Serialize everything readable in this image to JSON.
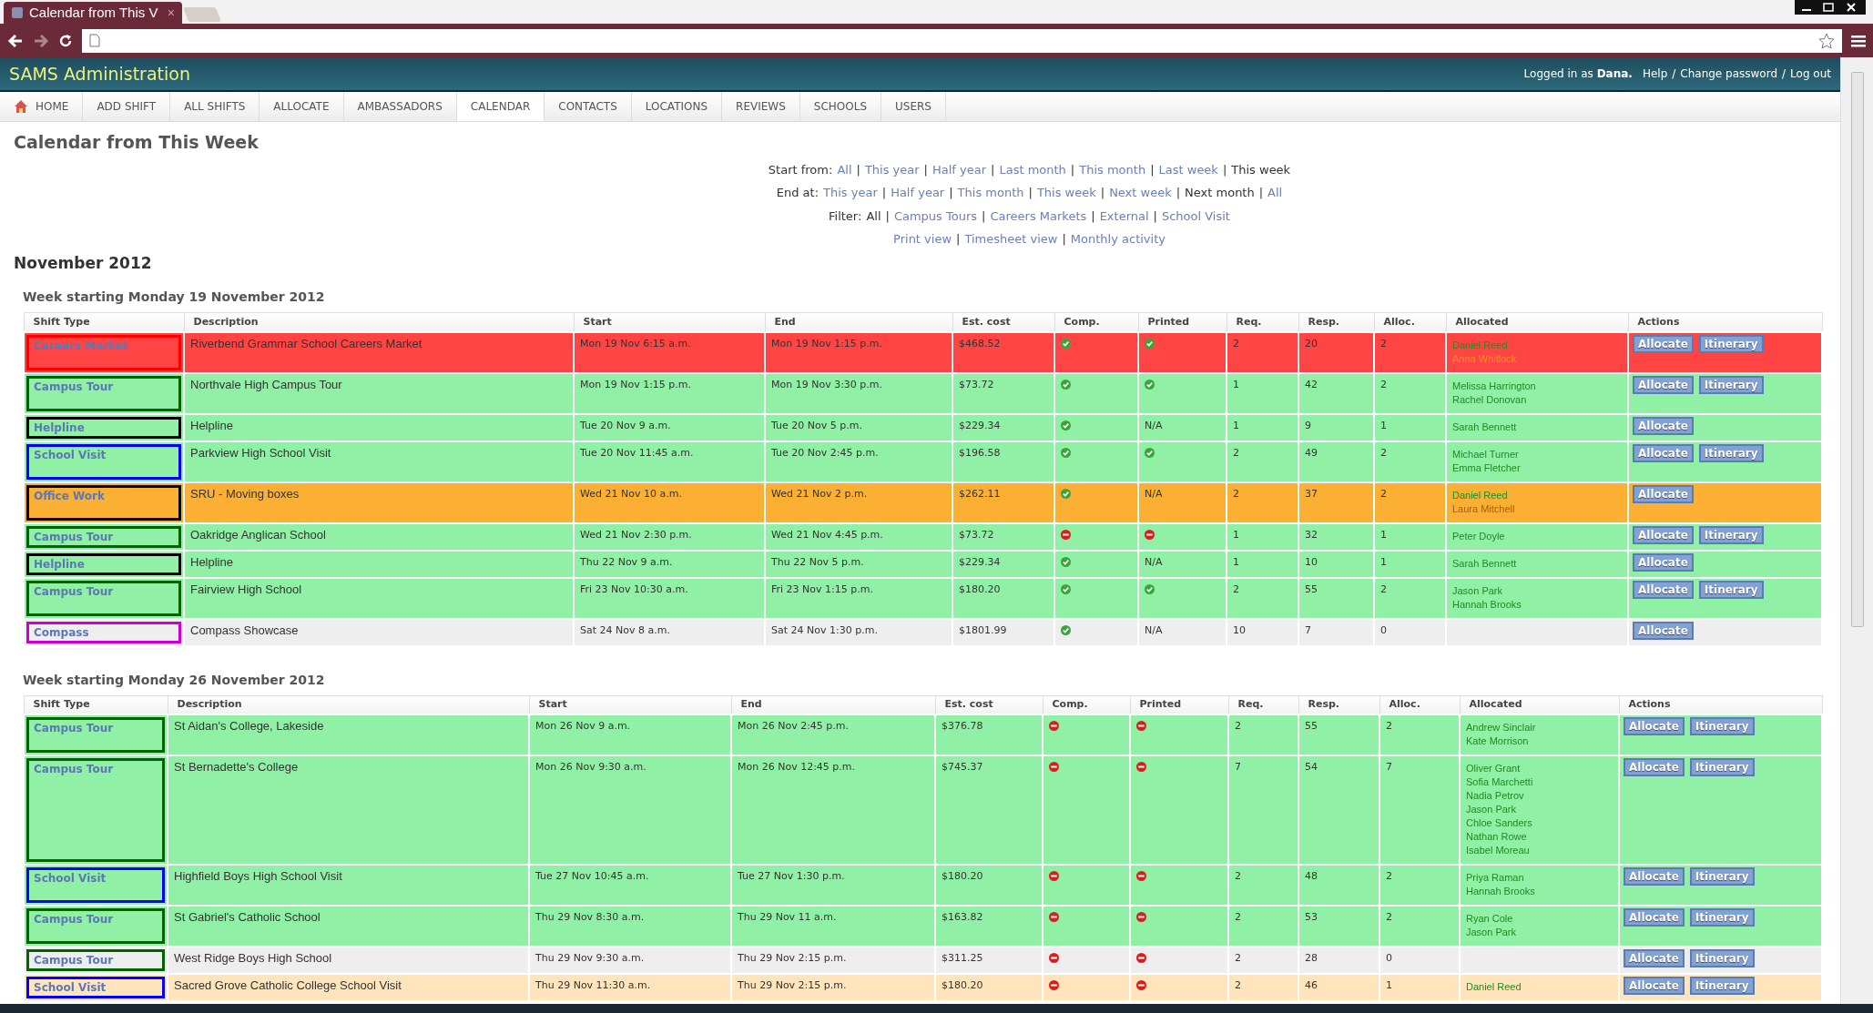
{
  "browser": {
    "tab_title": "Calendar from This V",
    "tab_close": "×"
  },
  "header": {
    "title": "SAMS Administration",
    "user_info": "Logged in as **Dana.**",
    "links": [
      "Help",
      "Change password",
      "Log out"
    ],
    "separator": "/"
  },
  "nav": [
    {
      "label": "HOME",
      "selected": false
    },
    {
      "label": "ADD SHIFT",
      "selected": false
    },
    {
      "label": "ALL SHIFTS",
      "selected": false
    },
    {
      "label": "ALLOCATE",
      "selected": false
    },
    {
      "label": "AMBASSADORS",
      "selected": false
    },
    {
      "label": "CALENDAR",
      "selected": true
    },
    {
      "label": "CONTACTS",
      "selected": false
    },
    {
      "label": "LOCATIONS",
      "selected": false
    },
    {
      "label": "REVIEWS",
      "selected": false
    },
    {
      "label": "SCHOOLS",
      "selected": false
    },
    {
      "label": "USERS",
      "selected": false
    }
  ],
  "page_title": "Calendar from This Week",
  "filters": [
    {
      "label": "Start from:",
      "separator": "|",
      "options": [
        {
          "text": "All",
          "selected": false
        },
        {
          "text": "This year",
          "selected": false
        },
        {
          "text": "Half year",
          "selected": false
        },
        {
          "text": "Last month",
          "selected": false
        },
        {
          "text": "This month",
          "selected": false
        },
        {
          "text": "Last week",
          "selected": false
        },
        {
          "text": "This week",
          "selected": true
        }
      ]
    },
    {
      "label": "End at:",
      "separator": "|",
      "options": [
        {
          "text": "This year",
          "selected": false
        },
        {
          "text": "Half year",
          "selected": false
        },
        {
          "text": "This month",
          "selected": false
        },
        {
          "text": "This week",
          "selected": false
        },
        {
          "text": "Next week",
          "selected": false
        },
        {
          "text": "Next month",
          "selected": true
        },
        {
          "text": "All",
          "selected": false
        }
      ]
    },
    {
      "label": "Filter:",
      "separator": "|",
      "options": [
        {
          "text": "All",
          "selected": true
        },
        {
          "text": "Campus Tours",
          "selected": false
        },
        {
          "text": "Careers Markets",
          "selected": false
        },
        {
          "text": "External",
          "selected": false
        },
        {
          "text": "School Visit",
          "selected": false
        }
      ]
    },
    {
      "separator": "|",
      "options": [
        {
          "text": "Print view",
          "selected": false
        },
        {
          "text": "Timesheet view",
          "selected": false
        },
        {
          "text": "Monthly activity",
          "selected": false
        }
      ]
    }
  ],
  "month": "November 2012",
  "weeks": [
    {
      "heading": "Week starting Monday 19 November 2012",
      "columns": [
        "Shift Type",
        "Description",
        "Start",
        "End",
        "Est. cost",
        "Comp.",
        "Printed",
        "Req.",
        "Resp.",
        "Alloc.",
        "Allocated",
        "Actions"
      ],
      "rows": [
        {
          "color": "#ff4444",
          "shift_type": {
            "label": "Careers Market",
            "color": "#ff0000"
          },
          "description": "Riverbend Grammar School Careers Market",
          "start": "Mon 19 Nov 6:15 a.m.",
          "end": "Mon 19 Nov 1:15 p.m.",
          "cost": "$468.52",
          "comp": true,
          "printed": {
            "kind": "mark",
            "done": true
          },
          "req": "2",
          "resp": "20",
          "alloc": "2",
          "allocated": [
            {
              "name": "Daniel Reed",
              "color": "#1e8c1e"
            },
            {
              "name": "Anna Whitlock",
              "color": "#e8961e"
            }
          ],
          "actions": [
            "Allocate",
            "Itinerary"
          ]
        },
        {
          "color": "#90f0a6",
          "shift_type": {
            "label": "Campus Tour",
            "color": "#006400"
          },
          "description": "Northvale High Campus Tour",
          "start": "Mon 19 Nov 1:15 p.m.",
          "end": "Mon 19 Nov 3:30 p.m.",
          "cost": "$73.72",
          "comp": true,
          "printed": {
            "kind": "mark",
            "done": true
          },
          "req": "1",
          "resp": "42",
          "alloc": "2",
          "allocated": [
            {
              "name": "Melissa Harrington",
              "color": "#1e8c1e"
            },
            {
              "name": "Rachel Donovan",
              "color": "#1e8c1e"
            }
          ],
          "actions": [
            "Allocate",
            "Itinerary"
          ]
        },
        {
          "color": "#90f0a6",
          "shift_type": {
            "label": "Helpline",
            "color": "#000000"
          },
          "description": "Helpline",
          "start": "Tue 20 Nov 9 a.m.",
          "end": "Tue 20 Nov 5 p.m.",
          "cost": "$229.34",
          "comp": true,
          "printed": {
            "kind": "text",
            "text": "N/A"
          },
          "req": "1",
          "resp": "9",
          "alloc": "1",
          "allocated": [
            {
              "name": "Sarah Bennett",
              "color": "#1e8c1e"
            }
          ],
          "actions": [
            "Allocate"
          ]
        },
        {
          "color": "#90f0a6",
          "shift_type": {
            "label": "School Visit",
            "color": "#0000ff"
          },
          "description": "Parkview High School Visit",
          "start": "Tue 20 Nov 11:45 a.m.",
          "end": "Tue 20 Nov 2:45 p.m.",
          "cost": "$196.58",
          "comp": true,
          "printed": {
            "kind": "mark",
            "done": true
          },
          "req": "2",
          "resp": "49",
          "alloc": "2",
          "allocated": [
            {
              "name": "Michael Turner",
              "color": "#1e8c1e"
            },
            {
              "name": "Emma Fletcher",
              "color": "#1e8c1e"
            }
          ],
          "actions": [
            "Allocate",
            "Itinerary"
          ]
        },
        {
          "color": "#fbb034",
          "shift_type": {
            "label": "Office Work",
            "color": "#000000"
          },
          "description": "SRU - Moving boxes",
          "start": "Wed 21 Nov 10 a.m.",
          "end": "Wed 21 Nov 2 p.m.",
          "cost": "$262.11",
          "comp": true,
          "printed": {
            "kind": "text",
            "text": "N/A"
          },
          "req": "2",
          "resp": "37",
          "alloc": "2",
          "allocated": [
            {
              "name": "Daniel Reed",
              "color": "#1e8c1e"
            },
            {
              "name": "Laura Mitchell",
              "color": "#a85a08"
            }
          ],
          "actions": [
            "Allocate"
          ]
        },
        {
          "color": "#90f0a6",
          "shift_type": {
            "label": "Campus Tour",
            "color": "#006400"
          },
          "description": "Oakridge Anglican School",
          "start": "Wed 21 Nov 2:30 p.m.",
          "end": "Wed 21 Nov 4:45 p.m.",
          "cost": "$73.72",
          "comp": false,
          "printed": {
            "kind": "mark",
            "done": false
          },
          "req": "1",
          "resp": "32",
          "alloc": "1",
          "allocated": [
            {
              "name": "Peter Doyle",
              "color": "#1e8c1e"
            }
          ],
          "actions": [
            "Allocate",
            "Itinerary"
          ]
        },
        {
          "color": "#90f0a6",
          "shift_type": {
            "label": "Helpline",
            "color": "#000000"
          },
          "description": "Helpline",
          "start": "Thu 22 Nov 9 a.m.",
          "end": "Thu 22 Nov 5 p.m.",
          "cost": "$229.34",
          "comp": true,
          "printed": {
            "kind": "text",
            "text": "N/A"
          },
          "req": "1",
          "resp": "10",
          "alloc": "1",
          "allocated": [
            {
              "name": "Sarah Bennett",
              "color": "#1e8c1e"
            }
          ],
          "actions": [
            "Allocate"
          ]
        },
        {
          "color": "#90f0a6",
          "shift_type": {
            "label": "Campus Tour",
            "color": "#006400"
          },
          "description": "Fairview High School",
          "start": "Fri 23 Nov 10:30 a.m.",
          "end": "Fri 23 Nov 1:15 p.m.",
          "cost": "$180.20",
          "comp": true,
          "printed": {
            "kind": "mark",
            "done": true
          },
          "req": "2",
          "resp": "55",
          "alloc": "2",
          "allocated": [
            {
              "name": "Jason Park",
              "color": "#1e8c1e"
            },
            {
              "name": "Hannah Brooks",
              "color": "#1e8c1e"
            }
          ],
          "actions": [
            "Allocate",
            "Itinerary"
          ]
        },
        {
          "color": "#eeeeee",
          "shift_type": {
            "label": "Compass",
            "color": "#cc00cc"
          },
          "description": "Compass Showcase",
          "start": "Sat 24 Nov 8 a.m.",
          "end": "Sat 24 Nov 1:30 p.m.",
          "cost": "$1801.99",
          "comp": true,
          "printed": {
            "kind": "text",
            "text": "N/A"
          },
          "req": "10",
          "resp": "7",
          "alloc": "0",
          "actions": [
            "Allocate"
          ]
        }
      ]
    },
    {
      "heading": "Week starting Monday 26 November 2012",
      "columns": [
        "Shift Type",
        "Description",
        "Start",
        "End",
        "Est. cost",
        "Comp.",
        "Printed",
        "Req.",
        "Resp.",
        "Alloc.",
        "Allocated",
        "Actions"
      ],
      "rows": [
        {
          "color": "#90f0a6",
          "shift_type": {
            "label": "Campus Tour",
            "color": "#006400"
          },
          "description": "St Aidan's College, Lakeside",
          "start": "Mon 26 Nov 9 a.m.",
          "end": "Mon 26 Nov 2:45 p.m.",
          "cost": "$376.78",
          "comp": false,
          "printed": {
            "kind": "mark",
            "done": false
          },
          "req": "2",
          "resp": "55",
          "alloc": "2",
          "allocated": [
            {
              "name": "Andrew Sinclair",
              "color": "#1e8c1e"
            },
            {
              "name": "Kate Morrison",
              "color": "#1e8c1e"
            }
          ],
          "actions": [
            "Allocate",
            "Itinerary"
          ]
        },
        {
          "color": "#90f0a6",
          "shift_type": {
            "label": "Campus Tour",
            "color": "#006400"
          },
          "description": "St Bernadette's College",
          "start": "Mon 26 Nov 9:30 a.m.",
          "end": "Mon 26 Nov 12:45 p.m.",
          "cost": "$745.37",
          "comp": false,
          "printed": {
            "kind": "mark",
            "done": false
          },
          "req": "7",
          "resp": "54",
          "alloc": "7",
          "allocated": [
            {
              "name": "Oliver Grant",
              "color": "#1e8c1e"
            },
            {
              "name": "Sofia Marchetti",
              "color": "#1e8c1e"
            },
            {
              "name": "Nadia Petrov",
              "color": "#1e8c1e"
            },
            {
              "name": "Jason Park",
              "color": "#1e8c1e"
            },
            {
              "name": "Chloe Sanders",
              "color": "#1e8c1e"
            },
            {
              "name": "Nathan Rowe",
              "color": "#1e8c1e"
            },
            {
              "name": "Isabel Moreau",
              "color": "#1e8c1e"
            }
          ],
          "actions": [
            "Allocate",
            "Itinerary"
          ]
        },
        {
          "color": "#90f0a6",
          "shift_type": {
            "label": "School Visit",
            "color": "#0000ff"
          },
          "description": "Highfield Boys High School Visit",
          "start": "Tue 27 Nov 10:45 a.m.",
          "end": "Tue 27 Nov 1:30 p.m.",
          "cost": "$180.20",
          "comp": false,
          "printed": {
            "kind": "mark",
            "done": false
          },
          "req": "2",
          "resp": "48",
          "alloc": "2",
          "allocated": [
            {
              "name": "Priya Raman",
              "color": "#1e8c1e"
            },
            {
              "name": "Hannah Brooks",
              "color": "#1e8c1e"
            }
          ],
          "actions": [
            "Allocate",
            "Itinerary"
          ]
        },
        {
          "color": "#90f0a6",
          "shift_type": {
            "label": "Campus Tour",
            "color": "#006400"
          },
          "description": "St Gabriel's Catholic School",
          "start": "Thu 29 Nov 8:30 a.m.",
          "end": "Thu 29 Nov 11 a.m.",
          "cost": "$163.82",
          "comp": false,
          "printed": {
            "kind": "mark",
            "done": false
          },
          "req": "2",
          "resp": "53",
          "alloc": "2",
          "allocated": [
            {
              "name": "Ryan Cole",
              "color": "#1e8c1e"
            },
            {
              "name": "Jason Park",
              "color": "#1e8c1e"
            }
          ],
          "actions": [
            "Allocate",
            "Itinerary"
          ]
        },
        {
          "color": "#eeeeee",
          "shift_type": {
            "label": "Campus Tour",
            "color": "#006400"
          },
          "description": "West Ridge Boys High School",
          "start": "Thu 29 Nov 9:30 a.m.",
          "end": "Thu 29 Nov 2:15 p.m.",
          "cost": "$311.25",
          "comp": false,
          "printed": {
            "kind": "mark",
            "done": false
          },
          "req": "2",
          "resp": "28",
          "alloc": "0",
          "actions": [
            "Allocate",
            "Itinerary"
          ]
        },
        {
          "color": "#ffe4bc",
          "shift_type": {
            "label": "School Visit",
            "color": "#0000ff"
          },
          "description": "Sacred Grove Catholic College School Visit",
          "start": "Thu 29 Nov 11:30 a.m.",
          "end": "Thu 29 Nov 2:15 p.m.",
          "cost": "$180.20",
          "comp": false,
          "printed": {
            "kind": "mark",
            "done": false
          },
          "req": "2",
          "resp": "46",
          "alloc": "1",
          "allocated": [
            {
              "name": "Daniel Reed",
              "color": "#1e8c1e"
            }
          ],
          "actions": [
            "Allocate",
            "Itinerary"
          ]
        }
      ]
    }
  ]
}
